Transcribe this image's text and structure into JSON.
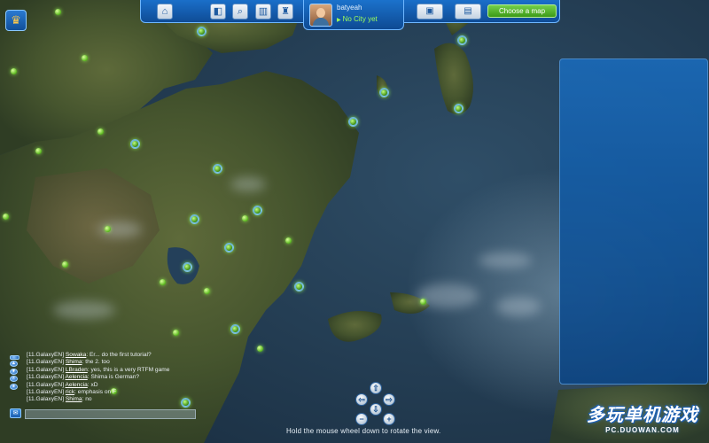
{
  "top_bar": {
    "username": "batyeah",
    "city_status": "No City yet",
    "choose_map_label": "Choose a map",
    "icons": [
      "home-icon",
      "view-icon",
      "zoom-icon",
      "stats-icon",
      "trophy-icon",
      "region-icon",
      "map-icon"
    ]
  },
  "chat": {
    "messages": [
      {
        "channel": "[11.GalaxyEN]",
        "user": "Sowaka",
        "text": ": Er... do the first tutorial?"
      },
      {
        "channel": "[11.GalaxyEN]",
        "user": "Shima",
        "text": ": the 2. too"
      },
      {
        "channel": "[11.GalaxyEN]",
        "user": "LBraden",
        "text": ": yes, this is a very RTFM game"
      },
      {
        "channel": "[11.GalaxyEN]",
        "user": "Aelencia",
        "text": ": Shima is German?"
      },
      {
        "channel": "[11.GalaxyEN]",
        "user": "Aelencia",
        "text": ": xD"
      },
      {
        "channel": "[11.GalaxyEN]",
        "user": "rick",
        "text": ": emphasis on F"
      },
      {
        "channel": "[11.GalaxyEN]",
        "user": "Shima",
        "text": ": no"
      }
    ],
    "input_value": ""
  },
  "navigation": {
    "hint": "Hold the mouse wheel down to rotate the view."
  },
  "watermark": {
    "main": "多玩单机游戏",
    "sub": "PC.DUOWAN.COM"
  },
  "colors": {
    "panel_blue": "#1b6ab8",
    "accent_green": "#4fb51f",
    "status_green": "#9dff5a"
  }
}
